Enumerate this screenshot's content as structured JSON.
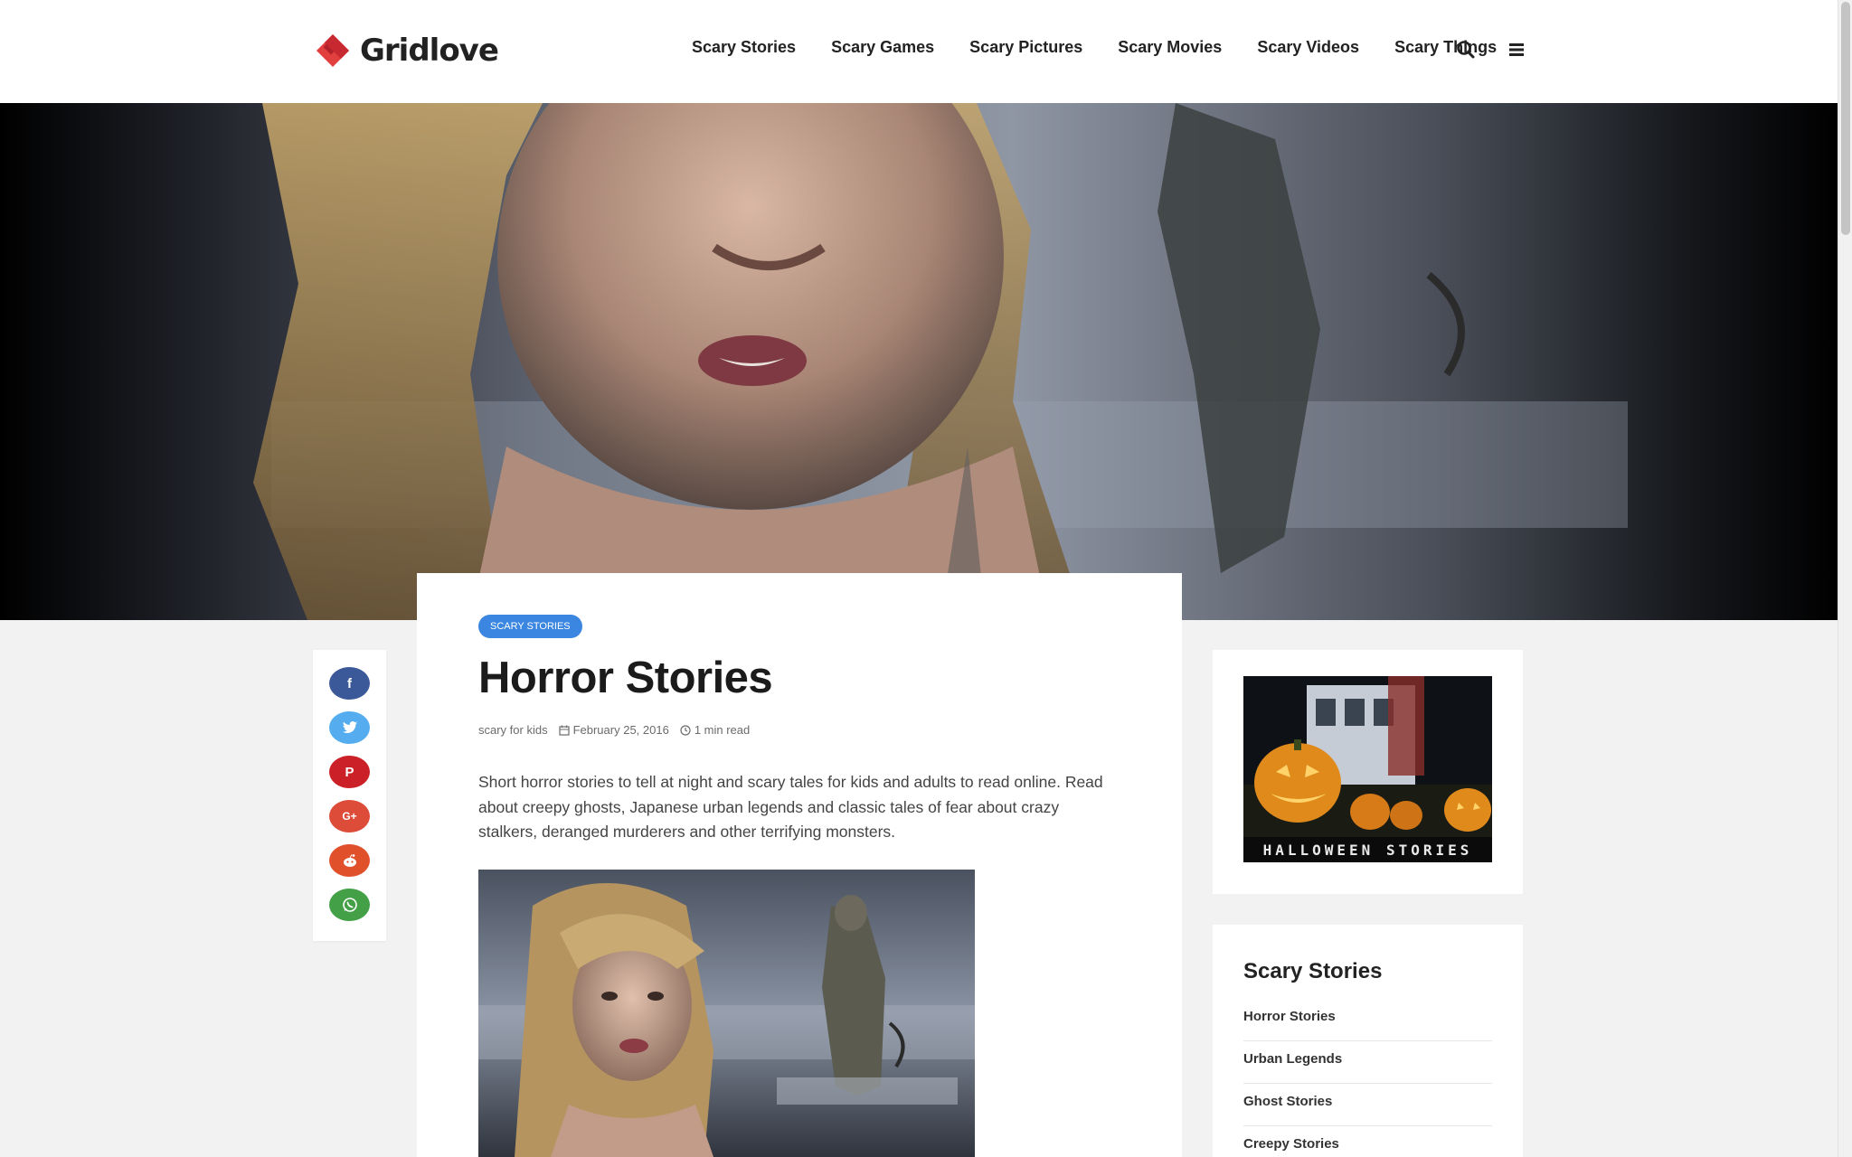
{
  "site": {
    "logo_text": "Gridlove",
    "brand_color": "#d6333a"
  },
  "nav": {
    "items": [
      "Scary Stories",
      "Scary Games",
      "Scary Pictures",
      "Scary Movies",
      "Scary Videos",
      "Scary Things"
    ],
    "search_icon": "search-icon",
    "menu_icon": "hamburger-menu-icon"
  },
  "hero": {
    "image": "hero-image"
  },
  "share": {
    "buttons": [
      {
        "name": "facebook",
        "glyph": "f",
        "color": "#3b5998"
      },
      {
        "name": "twitter",
        "glyph": "t",
        "color": "#55acee"
      },
      {
        "name": "pinterest",
        "glyph": "P",
        "color": "#cb2027"
      },
      {
        "name": "google-plus",
        "glyph": "G+",
        "color": "#dd4b39"
      },
      {
        "name": "reddit",
        "glyph": "r",
        "color": "#e0512b"
      },
      {
        "name": "whatsapp",
        "glyph": "w",
        "color": "#43a047"
      }
    ]
  },
  "article": {
    "category": "SCARY STORIES",
    "category_color": "#3a86e0",
    "title": "Horror Stories",
    "author": "scary for kids",
    "date": "February 25, 2016",
    "read_time": "1 min read",
    "excerpt": "Short horror stories to tell at night and scary tales for kids and adults to read online. Read about creepy ghosts, Japanese urban legends and classic tales of fear about crazy stalkers, deranged murderers and other terrifying monsters."
  },
  "sidebar": {
    "ad_caption": "HALLOWEEN STORIES",
    "widget_title": "Scary Stories",
    "links": [
      "Horror Stories",
      "Urban Legends",
      "Ghost Stories",
      "Creepy Stories"
    ]
  }
}
